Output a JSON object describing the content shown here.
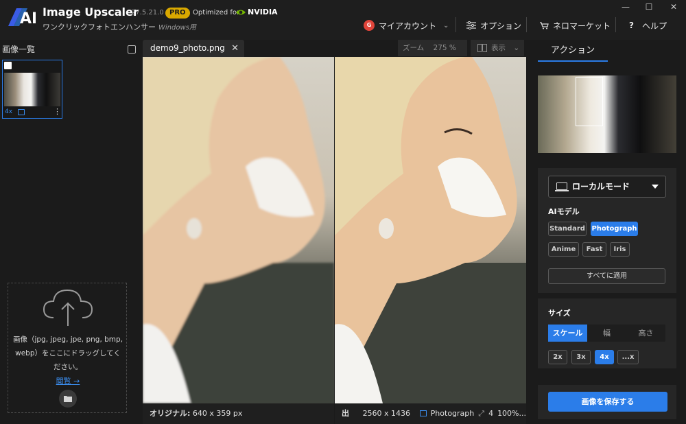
{
  "app": {
    "name": "Image Upscaler",
    "version": "27.5.21.0",
    "pro_badge": "PRO",
    "optimized_for": "Optimized for",
    "nvidia": "NVIDIA",
    "subtitle": "ワンクリックフォトエンハンサー",
    "subtitle_os": "Windows用",
    "logo_text": "AI"
  },
  "window_controls": {
    "minimize": "—",
    "maximize": "☐",
    "close": "✕"
  },
  "top_menu": {
    "avatar_letter": "G",
    "account": "マイアカウント",
    "options": "オプション",
    "market": "ネロマーケット",
    "help": "ヘルプ",
    "help_symbol": "?"
  },
  "left_panel": {
    "title": "画像一覧",
    "thumbnail": {
      "scale": "4x",
      "more": "⋮"
    },
    "dropzone": {
      "text": "画像（jpg, jpeg, jpe, png, bmp, webp）をここにドラッグしてください。",
      "link": "閲覧 →"
    }
  },
  "center": {
    "tab_filename": "demo9_photo.png",
    "tab_close": "✕",
    "zoom_label": "ズーム",
    "zoom_value": "275 %",
    "view_label": "表示",
    "chevron": "⌄",
    "status_original_label": "オリジナル:",
    "status_original_value": "640 x 359 px",
    "status_output_label": "出力:",
    "status_output_value": "2560 x 1436 ...",
    "status_model": "Photograph",
    "status_scale": "4",
    "status_zoom": "100%..."
  },
  "right_panel": {
    "action_tab": "アクション",
    "mode_select": "ローカルモード",
    "ai_model_label": "AIモデル",
    "models": [
      "Standard",
      "Photograph",
      "Anime",
      "Fast",
      "Iris"
    ],
    "active_model": "Photograph",
    "apply_all": "すべてに適用",
    "size_label": "サイズ",
    "size_tabs": [
      "スケール",
      "幅",
      "高さ"
    ],
    "active_size_tab": "スケール",
    "scales": [
      "2x",
      "3x",
      "4x",
      "...x"
    ],
    "active_scale": "4x",
    "save_button": "画像を保存する"
  },
  "colors": {
    "accent": "#2b7de9",
    "pro": "#d9a800",
    "nvidia_green": "#76b900",
    "avatar": "#e0443a"
  }
}
